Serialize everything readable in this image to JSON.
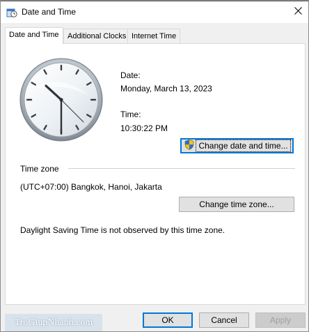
{
  "window": {
    "title": "Date and Time"
  },
  "tabs": [
    {
      "label": "Date and Time",
      "active": true
    },
    {
      "label": "Additional Clocks",
      "active": false
    },
    {
      "label": "Internet Time",
      "active": false
    }
  ],
  "date": {
    "label": "Date:",
    "value": "Monday, March 13, 2023"
  },
  "time": {
    "label": "Time:",
    "value": "10:30:22 PM"
  },
  "buttons": {
    "change_datetime": "Change date and time...",
    "change_timezone": "Change time zone...",
    "ok": "OK",
    "cancel": "Cancel",
    "apply": "Apply"
  },
  "timezone": {
    "heading": "Time zone",
    "value": "(UTC+07:00) Bangkok, Hanoi, Jakarta"
  },
  "dst_note": "Daylight Saving Time is not observed by this time zone.",
  "watermark": "TroGiupNhanh.com",
  "colors": {
    "accent": "#0078d7",
    "window_bg": "#f0f0f0",
    "panel_bg": "#ffffff"
  }
}
